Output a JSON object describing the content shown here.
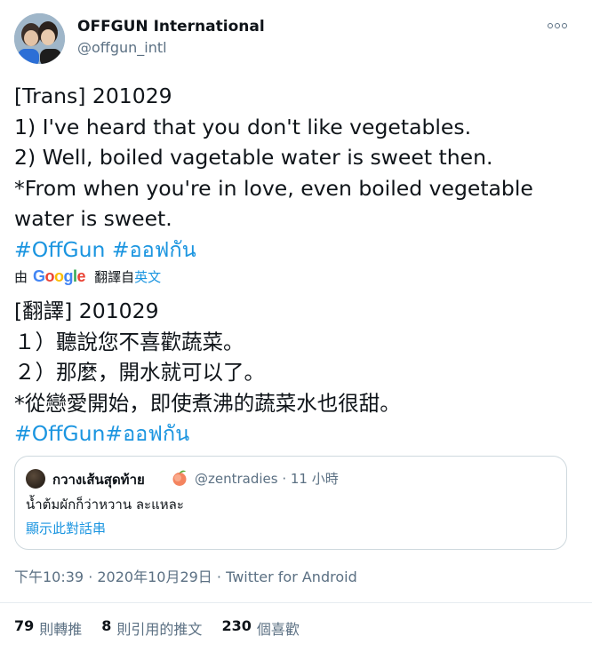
{
  "author": {
    "name": "OFFGUN International",
    "handle": "@offgun_intl"
  },
  "tweet_lines": [
    "[Trans] 201029",
    "1) I've heard that you don't like vegetables.",
    "2) Well, boiled vagetable water is sweet then.",
    "*From when you're in love, even boiled vegetable",
    "water is sweet."
  ],
  "hashtags": "#OffGun #ออฟกัน",
  "translation": {
    "prefix": "由",
    "provider": "Google",
    "translated_from": "翻譯自",
    "source_language": "英文"
  },
  "translated_lines": [
    "[翻譯] 201029",
    "１）聽說您不喜歡蔬菜。",
    "２）那麼，開水就可以了。",
    "*從戀愛開始，即使煮沸的蔬菜水也很甜。"
  ],
  "translated_hashtags": "#OffGun#ออฟกัน",
  "quote": {
    "name": "กวางเส้นสุดท้าย",
    "handle_time": "@zentradies · 11 小時",
    "text": "น้ำต้มผักก็ว่าหวาน ละแหละ",
    "show_thread": "顯示此對話串"
  },
  "meta": "下午10:39 · 2020年10月29日 · Twitter for Android",
  "stats": {
    "retweets": {
      "count": "79",
      "label": "則轉推"
    },
    "quotes": {
      "count": "8",
      "label": "則引用的推文"
    },
    "likes": {
      "count": "230",
      "label": "個喜歡"
    }
  },
  "colors": {
    "accent": "#1b95e0",
    "secondary_text": "#5b7083",
    "text": "#0f1419"
  }
}
